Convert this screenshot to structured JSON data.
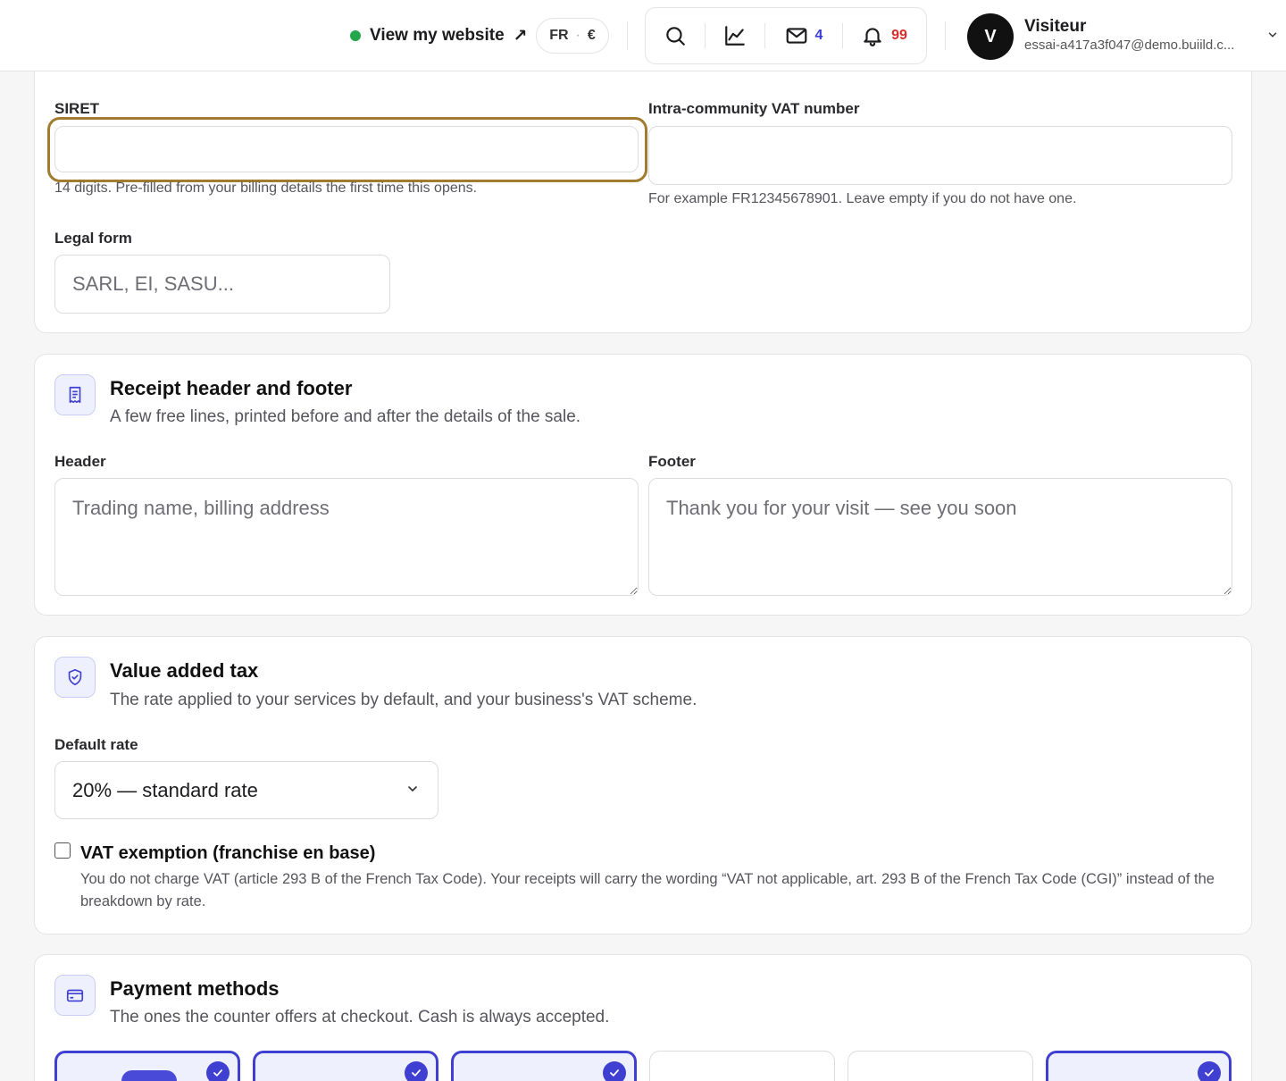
{
  "topbar": {
    "view_site_label": "View my website",
    "view_site_arrow": "↗",
    "lang": "FR",
    "currency": "€",
    "messages_count": "4",
    "notifications_count": "99",
    "user": {
      "initial": "V",
      "name": "Visiteur",
      "email": "essai-a417a3f047@demo.buiild.c..."
    },
    "status_color": "#22a84a"
  },
  "legal": {
    "siret_label": "SIRET",
    "siret_value": "",
    "siret_help": "14 digits. Pre-filled from your billing details the first time this opens.",
    "vat_label": "Intra-community VAT number",
    "vat_value": "",
    "vat_help": "For example FR12345678901. Leave empty if you do not have one.",
    "legal_form_label": "Legal form",
    "legal_form_placeholder": "SARL, EI, SASU..."
  },
  "receipt": {
    "title": "Receipt header and footer",
    "subtitle": "A few free lines, printed before and after the details of the sale.",
    "header_label": "Header",
    "header_placeholder": "Trading name, billing address",
    "footer_label": "Footer",
    "footer_placeholder": "Thank you for your visit — see you soon"
  },
  "vat": {
    "title": "Value added tax",
    "subtitle": "The rate applied to your services by default, and your business's VAT scheme.",
    "rate_label": "Default rate",
    "rate_selected": "20% — standard rate",
    "exemption_title": "VAT exemption (franchise en base)",
    "exemption_checked": false,
    "exemption_desc": "You do not charge VAT (article 293 B of the French Tax Code). Your receipts will carry the wording “VAT not applicable, art. 293 B of the French Tax Code (CGI)” instead of the breakdown by rate."
  },
  "payment": {
    "title": "Payment methods",
    "subtitle": "The ones the counter offers at checkout. Cash is always accepted.",
    "methods": [
      {
        "selected": true
      },
      {
        "selected": true
      },
      {
        "selected": true
      },
      {
        "selected": false
      },
      {
        "selected": false
      },
      {
        "selected": true
      }
    ]
  },
  "colors": {
    "accent": "#3f3fd1",
    "focus": "#a17b2e",
    "danger": "#d92d2d"
  }
}
